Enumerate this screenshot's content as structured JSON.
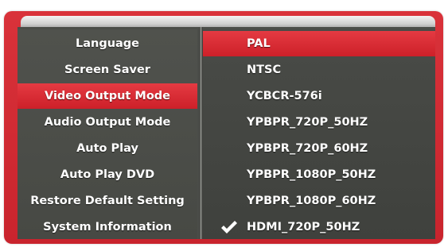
{
  "menu": {
    "items": [
      {
        "label": "Language"
      },
      {
        "label": "Screen Saver"
      },
      {
        "label": "Video Output Mode",
        "selected": true
      },
      {
        "label": "Audio Output Mode"
      },
      {
        "label": "Auto Play"
      },
      {
        "label": "Auto Play DVD"
      },
      {
        "label": "Restore Default Setting"
      },
      {
        "label": "System Information"
      }
    ]
  },
  "options": {
    "items": [
      {
        "label": "PAL",
        "highlighted": true
      },
      {
        "label": "NTSC"
      },
      {
        "label": "YCBCR-576i"
      },
      {
        "label": "YPBPR_720P_50HZ"
      },
      {
        "label": "YPBPR_720P_60HZ"
      },
      {
        "label": "YPBPR_1080P_50HZ"
      },
      {
        "label": "YPBPR_1080P_60HZ"
      },
      {
        "label": "HDMI_720P_50HZ",
        "checked": true,
        "icon": "checkmark-icon"
      }
    ]
  },
  "colors": {
    "frame_red": "#d9323a",
    "highlight_red": "#e43a42",
    "panel_gray": "#4b4d49",
    "text": "#ffffff"
  }
}
